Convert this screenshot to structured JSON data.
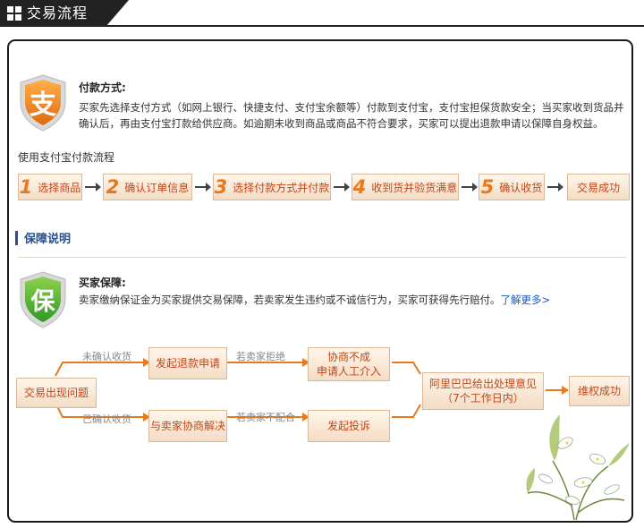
{
  "header": {
    "title": "交易流程"
  },
  "payment": {
    "icon_char": "支",
    "title": "付款方式:",
    "desc_line1": "买家先选择支付方式（如网上银行、快捷支付、支付宝余额等）付款到支付宝，支付宝担保货款安全；当买家收到货品并",
    "desc_line2": "确认后，再由支付宝打款给供应商。如逾期未收到商品或商品不符合要求，买家可以提出退款申请以保障自身权益。",
    "flow_title": "使用支付宝付款流程",
    "steps": [
      {
        "num": "1",
        "label": "选择商品"
      },
      {
        "num": "2",
        "label": "确认订单信息"
      },
      {
        "num": "3",
        "label": "选择付款方式并付款"
      },
      {
        "num": "4",
        "label": "收到货并验货满意"
      },
      {
        "num": "5",
        "label": "确认收货"
      },
      {
        "num": "",
        "label": "交易成功"
      }
    ]
  },
  "guarantee": {
    "section_title": "保障说明",
    "icon_char": "保",
    "title": "买家保障:",
    "desc": "卖家缴纳保证金为买家提供交易保障，若卖家发生违约或不诚信行为，买家可获得先行赔付。",
    "more_link": "了解更多>"
  },
  "dispute_flow": {
    "start": "交易出现问题",
    "upper_label": "未确认收货",
    "upper_box": "发起退款申请",
    "upper_label2": "若卖家拒绝",
    "upper_box2_line1": "协商不成",
    "upper_box2_line2": "申请人工介入",
    "lower_label": "已确认收货",
    "lower_box": "与卖家协商解决",
    "lower_label2": "若卖家不配合",
    "lower_box2": "发起投诉",
    "judge_line1": "阿里巴巴给出处理意见",
    "judge_line2": "（7个工作日内）",
    "end": "维权成功"
  },
  "colors": {
    "accent": "#e8791d",
    "step_text": "#c2461a",
    "section_blue": "#29508f",
    "link": "#1d56b8"
  }
}
